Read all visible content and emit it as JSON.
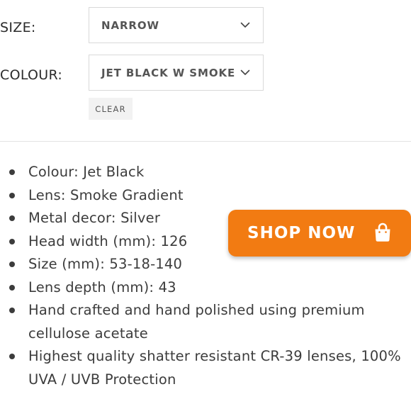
{
  "size": {
    "label": "SIZE:",
    "selected": "NARROW"
  },
  "colour": {
    "label": "COLOUR:",
    "selected": "JET BLACK W SMOKE"
  },
  "clear_label": "CLEAR",
  "features": [
    "Colour: Jet Black",
    "Lens: Smoke Gradient",
    "Metal decor: Silver",
    "Head width (mm): 126",
    "Size (mm): 53-18-140",
    "Lens depth (mm): 43",
    "Hand crafted and hand polished using premium cellulose acetate",
    "Highest quality shatter resistant CR-39 lenses, 100% UVA / UVB Protection"
  ],
  "shop_button": {
    "label": "SHOP NOW",
    "icon": "shopping-bag-icon",
    "color": "#f27b12"
  }
}
